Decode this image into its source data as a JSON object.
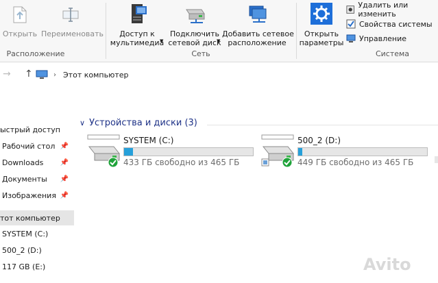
{
  "ribbon": {
    "location_group": {
      "label": "Расположение",
      "open_label": "Открыть",
      "rename_label": "Переименовать"
    },
    "network_group": {
      "label": "Сеть",
      "media_access_label": "Доступ к\nмультимедиа",
      "map_drive_label": "Подключить\nсетевой диск",
      "add_location_label": "Добавить сетевое\nрасположение"
    },
    "system_group": {
      "label": "Система",
      "open_settings_label": "Открыть\nпараметры",
      "uninstall_label": "Удалить или изменить",
      "system_properties_label": "Свойства системы",
      "manage_label": "Управление"
    }
  },
  "address": {
    "path": "Этот компьютер"
  },
  "nav": {
    "quick_access": "ыстрый доступ",
    "desktop": "Рабочий стол",
    "downloads": "Downloads",
    "documents": "Документы",
    "pictures": "Изображения",
    "this_pc": "тот компьютер",
    "drive_c": "SYSTEM (C:)",
    "drive_d": "500_2 (D:)",
    "drive_e": "117 GB (E:)"
  },
  "content": {
    "section_title": "Устройства и диски (3)",
    "drives": [
      {
        "name": "SYSTEM (C:)",
        "free_text": "433 ГБ свободно из 465 ГБ",
        "used_fraction": 0.069
      },
      {
        "name": "500_2 (D:)",
        "free_text": "449 ГБ свободно из 465 ГБ",
        "used_fraction": 0.034
      }
    ]
  },
  "watermark": "Avito",
  "colors": {
    "accent": "#26a0da",
    "section_title": "#1e3287",
    "selected_bg": "#e5e5e5"
  }
}
